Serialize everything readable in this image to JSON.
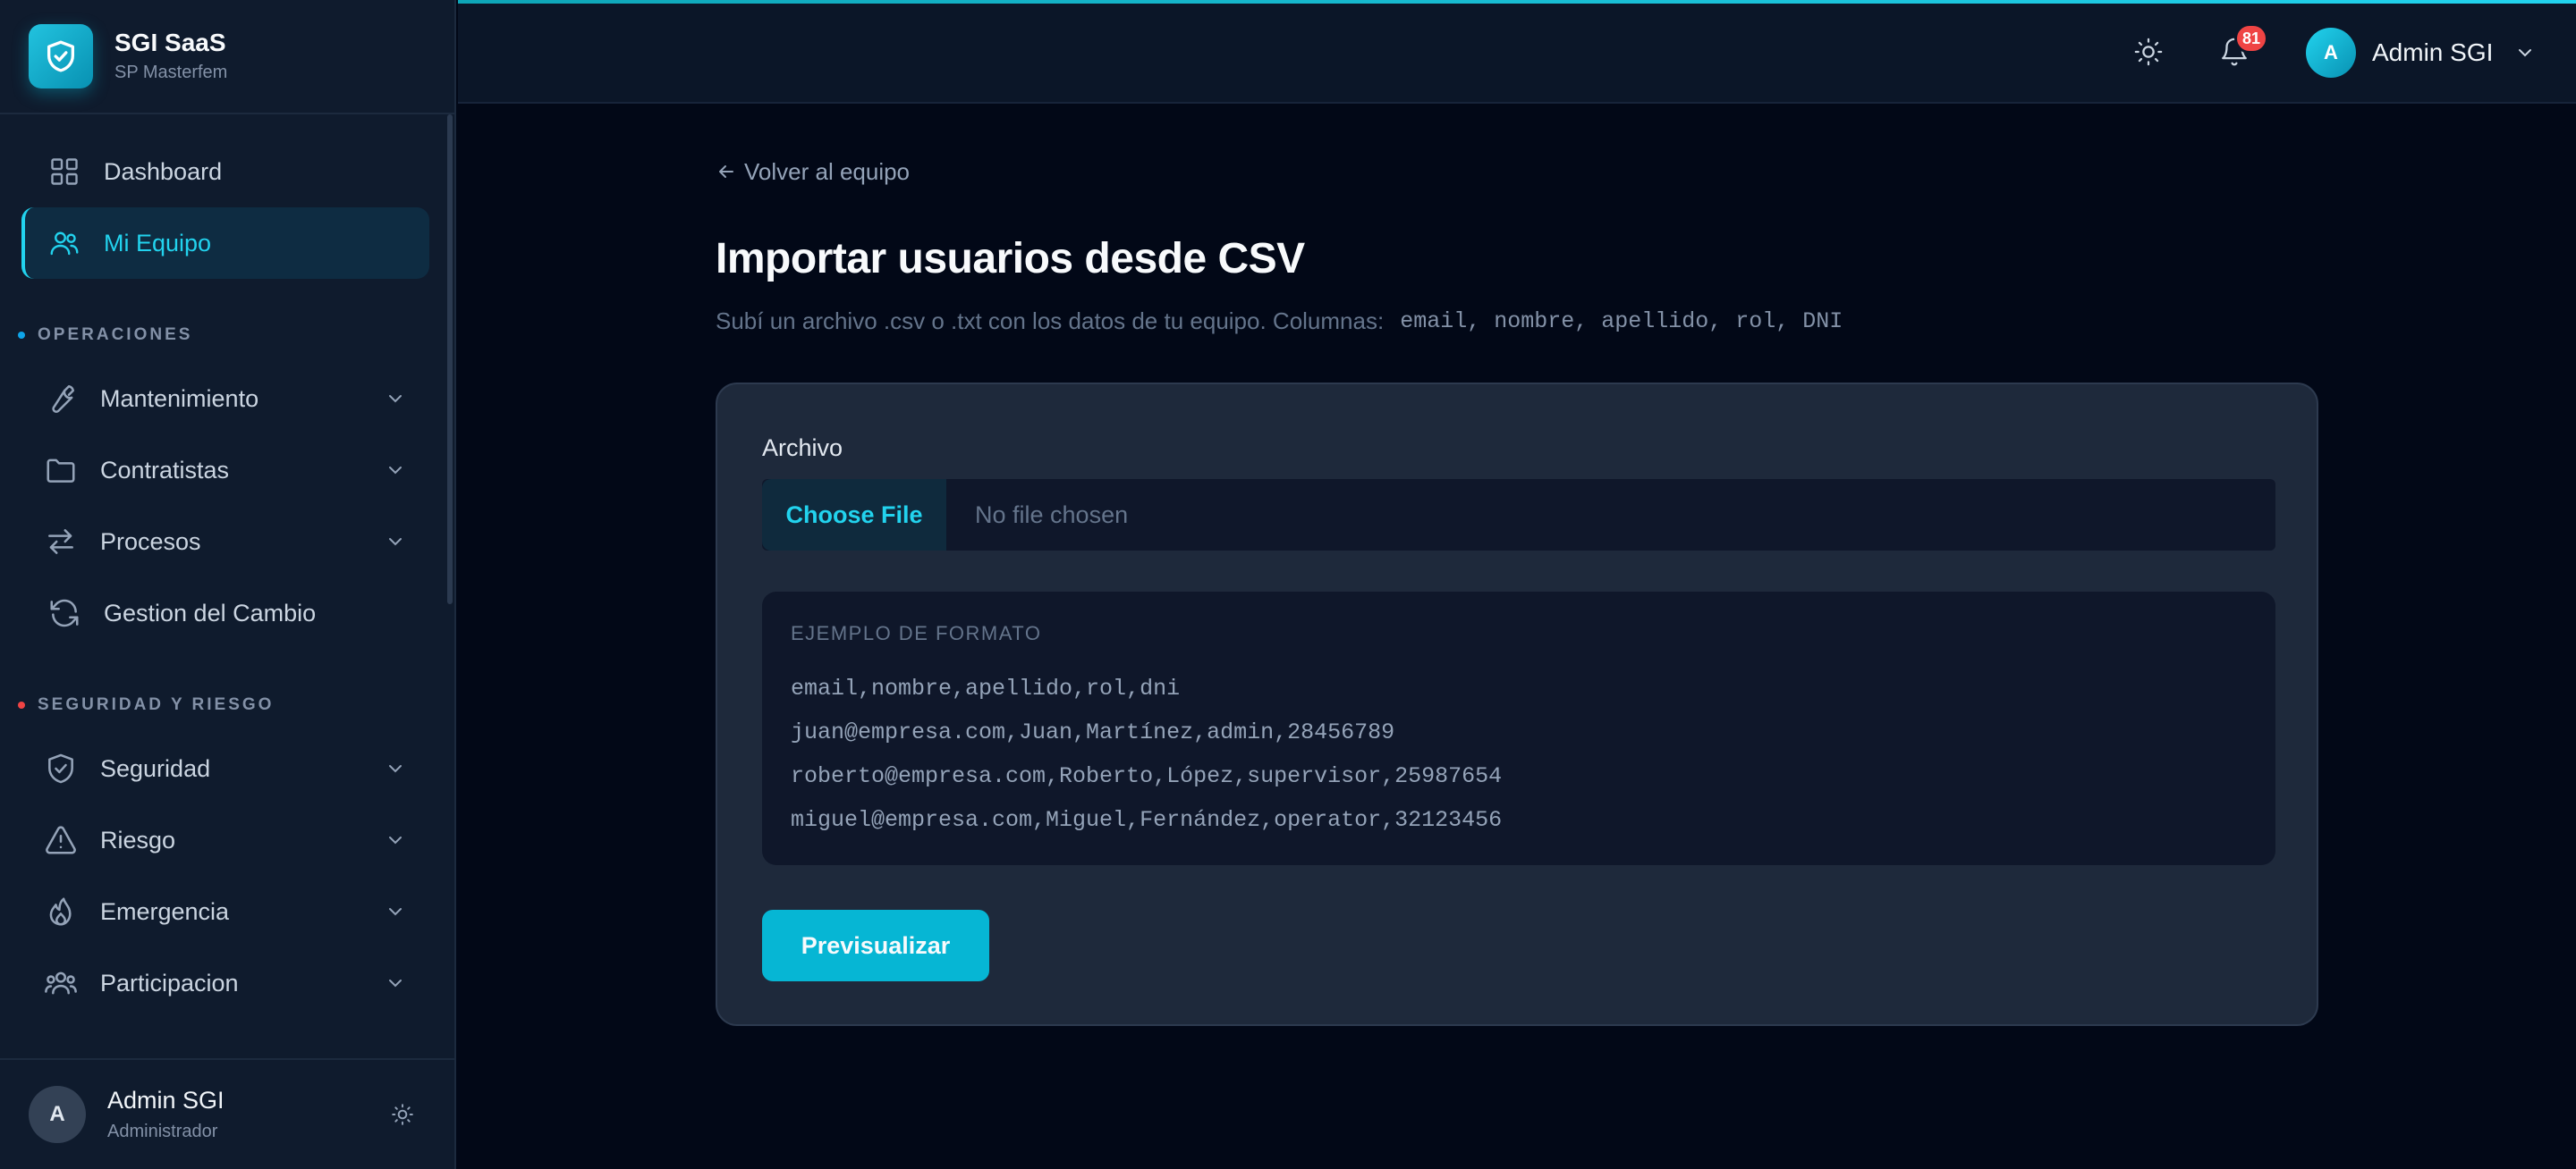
{
  "brand": {
    "name": "SGI SaaS",
    "subtitle": "SP Masterfem"
  },
  "sidebar": {
    "top_items": [
      {
        "label": "Dashboard",
        "icon": "grid-icon"
      },
      {
        "label": "Mi Equipo",
        "icon": "users-icon",
        "active": true
      }
    ],
    "sections": [
      {
        "title": "OPERACIONES",
        "dot_color": "#0ea5e9",
        "items": [
          {
            "label": "Mantenimiento",
            "icon": "wrench-icon",
            "expandable": true
          },
          {
            "label": "Contratistas",
            "icon": "folder-icon",
            "expandable": true
          },
          {
            "label": "Procesos",
            "icon": "arrows-icon",
            "expandable": true
          },
          {
            "label": "Gestion del Cambio",
            "icon": "refresh-icon",
            "expandable": false
          }
        ]
      },
      {
        "title": "SEGURIDAD Y RIESGO",
        "dot_color": "#ef4444",
        "items": [
          {
            "label": "Seguridad",
            "icon": "shield-check-icon",
            "expandable": true
          },
          {
            "label": "Riesgo",
            "icon": "warning-icon",
            "expandable": true
          },
          {
            "label": "Emergencia",
            "icon": "flame-icon",
            "expandable": true
          },
          {
            "label": "Participacion",
            "icon": "group-icon",
            "expandable": true
          }
        ]
      }
    ],
    "footer_user": {
      "initial": "A",
      "name": "Admin SGI",
      "role": "Administrador"
    }
  },
  "topbar": {
    "notification_count": "81",
    "user": {
      "initial": "A",
      "name": "Admin SGI"
    }
  },
  "main": {
    "back_link": "Volver al equipo",
    "title": "Importar usuarios desde CSV",
    "subtitle": "Subí un archivo .csv o .txt con los datos de tu equipo. Columnas:",
    "columns_text": "email, nombre, apellido, rol, DNI",
    "card": {
      "file_label": "Archivo",
      "choose_button": "Choose File",
      "no_file": "No file chosen",
      "example_title": "EJEMPLO DE FORMATO",
      "example_lines": [
        "email,nombre,apellido,rol,dni",
        "juan@empresa.com,Juan,Martínez,admin,28456789",
        "roberto@empresa.com,Roberto,López,supervisor,25987654",
        "miguel@empresa.com,Miguel,Fernández,operator,32123456"
      ],
      "preview_button": "Previsualizar"
    }
  },
  "colors": {
    "accent": "#06b6d4",
    "accent_text": "#22d3ee",
    "badge": "#ef4444"
  }
}
